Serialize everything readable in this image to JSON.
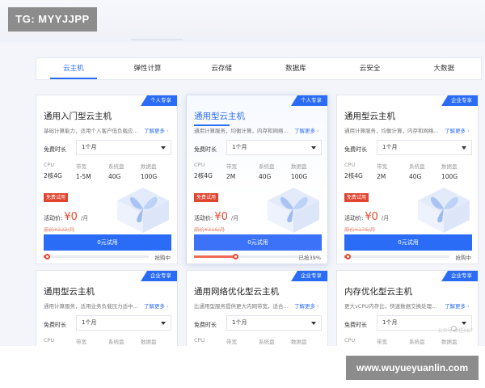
{
  "stamp": "TG: MYYJJPP",
  "url": "www.wuyueyuanlin.com",
  "tabs": [
    {
      "label": "云主机"
    },
    {
      "label": "弹性计算"
    },
    {
      "label": "云存储"
    },
    {
      "label": "数据库"
    },
    {
      "label": "云安全"
    },
    {
      "label": "大数据"
    }
  ],
  "common": {
    "duration_label": "免费时长",
    "duration_value": "1个月",
    "more": "了解更多",
    "free_badge": "免费试用",
    "price_label": "活动价:",
    "price_value": "¥0",
    "price_unit": "/月",
    "button": "0元试用",
    "spec_keys": [
      "CPU",
      "带宽",
      "系统盘",
      "数据盘"
    ]
  },
  "cards": [
    {
      "ribbon": "个人专享",
      "title": "通用入门型云主机",
      "desc": "基础计算能力，适用个人客户低负载应...",
      "specs": [
        "2核4G",
        "1-5M",
        "40G",
        "100G"
      ],
      "orig": "原价¥222/月",
      "progress_text": "抢购中",
      "progress": 0.03
    },
    {
      "ribbon": "个人专享",
      "title": "通用型云主机",
      "desc": "通用计算服务，均衡计算，内存和网络...",
      "specs": [
        "2核4G",
        "2M",
        "40G",
        "100G"
      ],
      "orig": "原价¥316/月",
      "progress_text": "已抢39%",
      "progress": 0.39
    },
    {
      "ribbon": "企业专享",
      "title": "通用型云主机",
      "desc": "通用计算服务，均衡计算，内存和网络...",
      "specs": [
        "2核4G",
        "2M",
        "40G",
        "100G"
      ],
      "orig": "原价¥176/月",
      "progress_text": "抢购中",
      "progress": 0.03
    },
    {
      "ribbon": "企业专享",
      "title": "通用型云主机",
      "desc": "通用计算服务，适用业务负载压力适中...",
      "specs": []
    },
    {
      "ribbon": "企业专享",
      "title": "通用网络优化型云主机",
      "desc": "比通用型服务提供更大内网带宽，适合...",
      "specs": []
    },
    {
      "ribbon": "企业专享",
      "title": "内存优化型云主机",
      "desc": "更大vCPU内存比，快速数据交换处理...",
      "specs": [],
      "watermark": "公众号·合信087"
    }
  ],
  "colors": {
    "accent": "#2a6cf5",
    "price": "#e6492f",
    "badge": "#e0452f"
  }
}
